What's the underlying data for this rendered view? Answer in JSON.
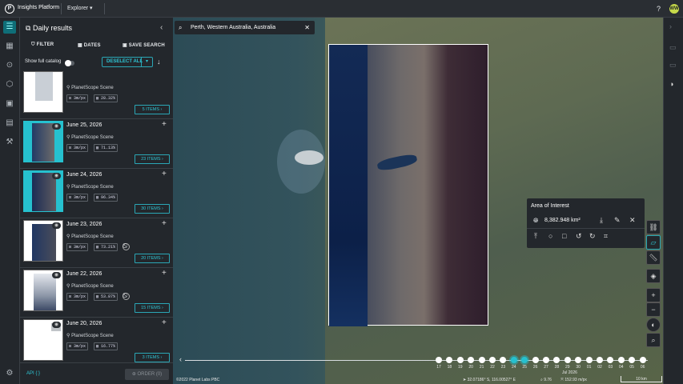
{
  "topbar": {
    "logo": "P",
    "app_name": "Insights Platform",
    "explorer": "Explorer",
    "avatar_initials": "WW"
  },
  "panel": {
    "title": "Daily results",
    "filter": "FILTER",
    "dates": "DATES",
    "save_search": "SAVE SEARCH",
    "show_full_catalog": "Show full catalog",
    "deselect_all": "DESELECT ALL",
    "cards": [
      {
        "date": "",
        "sensor": "PlanetScope Scene",
        "res": "3m/px",
        "cover": "28.32%",
        "items": "5 ITEMS"
      },
      {
        "date": "June 25, 2026",
        "sensor": "PlanetScope Scene",
        "res": "3m/px",
        "cover": "71.13%",
        "items": "23 ITEMS",
        "selected": true
      },
      {
        "date": "June 24, 2026",
        "sensor": "PlanetScope Scene",
        "res": "3m/px",
        "cover": "96.34%",
        "items": "30 ITEMS",
        "selected": true
      },
      {
        "date": "June 23, 2026",
        "sensor": "PlanetScope Scene",
        "res": "3m/px",
        "cover": "73.21%",
        "items": "20 ITEMS"
      },
      {
        "date": "June 22, 2026",
        "sensor": "PlanetScope Scene",
        "res": "3m/px",
        "cover": "53.87%",
        "items": "15 ITEMS"
      },
      {
        "date": "June 20, 2026",
        "sensor": "PlanetScope Scene",
        "res": "3m/px",
        "cover": "16.77%",
        "items": "3 ITEMS"
      }
    ],
    "api": "API {:}",
    "order": "ORDER (0)"
  },
  "search": {
    "value": "Perth, Western Australia, Australia"
  },
  "aoi": {
    "title": "Area of Interest",
    "area": "8,382.948 km²"
  },
  "timeline": {
    "days": [
      "17",
      "18",
      "19",
      "20",
      "21",
      "22",
      "23",
      "24",
      "25",
      "26",
      "27",
      "28",
      "29",
      "30",
      "01",
      "02",
      "03",
      "04",
      "05",
      "06"
    ],
    "selected": [
      "24",
      "25"
    ],
    "month": "Jul 2026"
  },
  "status": {
    "copyright": "©2022 Planet Labs PBC",
    "coords": "32.07186° S, 116.00527° E",
    "zoom": "9.76",
    "resolution": "152.93 m/px",
    "scale": "10 km"
  }
}
